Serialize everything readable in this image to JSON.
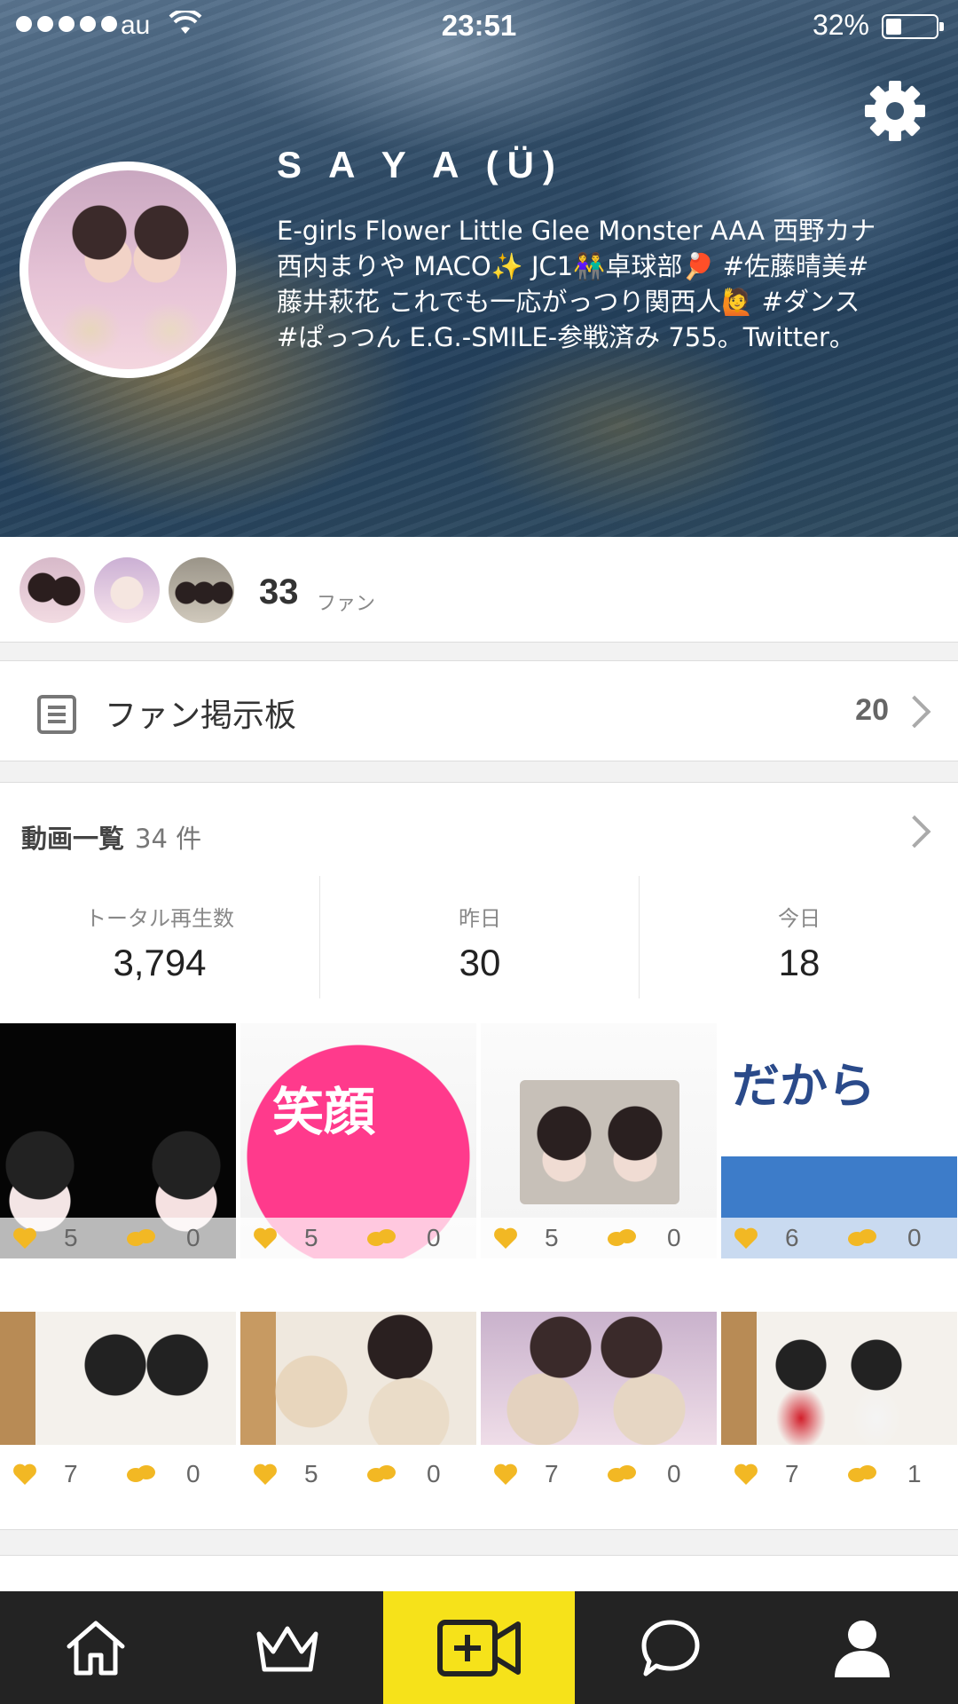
{
  "status_bar": {
    "carrier": "au",
    "time": "23:51",
    "battery_percent": "32%",
    "battery_level": 0.32
  },
  "profile": {
    "name": "S A Y A (Ü)",
    "bio": "E-girls Flower Little Glee Monster AAA 西野カナ\n西内まりや MACO✨ JC1👫卓球部🏓 #佐藤晴美#\n藤井萩花 これでも一応がっつり関西人🙋 #ダンス\n#ぱっつん E.G.-SMILE-参戦済み 755。Twitter。",
    "settings_icon": "gear-icon"
  },
  "fans": {
    "count": "33",
    "label": "ファン"
  },
  "fan_board": {
    "icon": "document-icon",
    "label": "ファン掲示板",
    "count": "20"
  },
  "videos": {
    "title": "動画一覧",
    "count_text": "34 件",
    "stats": [
      {
        "label": "トータル再生数",
        "value": "3,794"
      },
      {
        "label": "昨日",
        "value": "30"
      },
      {
        "label": "今日",
        "value": "18"
      }
    ],
    "items": [
      {
        "likes": "5",
        "comments": "0",
        "caption": ""
      },
      {
        "likes": "5",
        "comments": "0",
        "caption": "笑顔"
      },
      {
        "likes": "5",
        "comments": "0",
        "caption": ""
      },
      {
        "likes": "6",
        "comments": "0",
        "caption": "だから"
      },
      {
        "likes": "7",
        "comments": "0",
        "caption": ""
      },
      {
        "likes": "5",
        "comments": "0",
        "caption": ""
      },
      {
        "likes": "7",
        "comments": "0",
        "caption": ""
      },
      {
        "likes": "7",
        "comments": "1",
        "caption": ""
      }
    ]
  },
  "colors": {
    "accent_yellow": "#f6e21a",
    "icon_gold": "#f2b824",
    "tabbar_bg": "#232323"
  },
  "tabs": [
    {
      "icon": "home-icon"
    },
    {
      "icon": "crown-icon"
    },
    {
      "icon": "video-add-icon",
      "active": true
    },
    {
      "icon": "chat-bubble-icon"
    },
    {
      "icon": "profile-icon"
    }
  ]
}
